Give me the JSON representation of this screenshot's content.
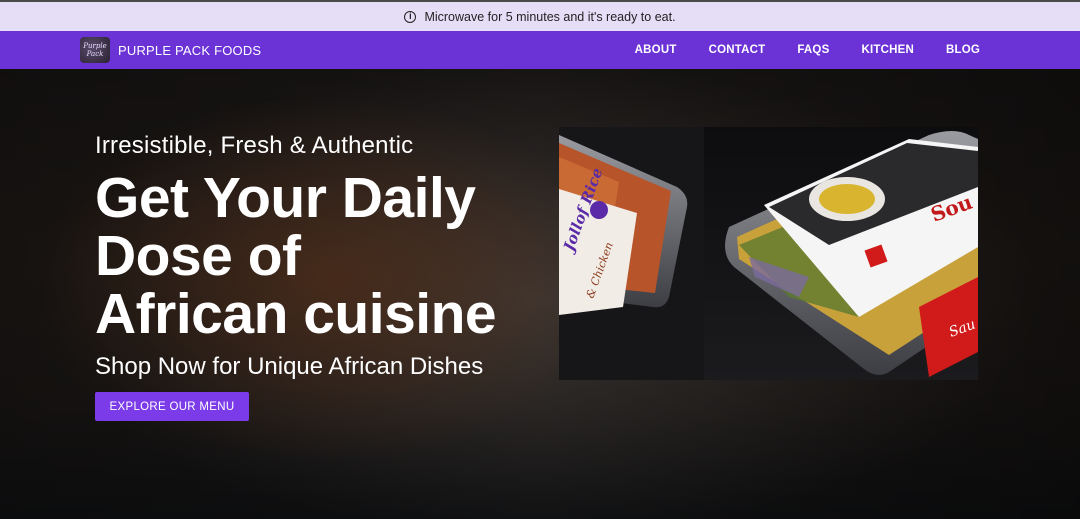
{
  "announcement": {
    "text": "Microwave for 5 minutes and it's ready to eat."
  },
  "brand": {
    "logo_text_top": "Purple",
    "logo_text_bottom": "Pack",
    "name": "PURPLE PACK FOODS"
  },
  "nav": {
    "items": [
      "ABOUT",
      "CONTACT",
      "FAQS",
      "KITCHEN",
      "BLOG"
    ]
  },
  "hero": {
    "eyebrow": "Irresistible, Fresh & Authentic",
    "headline_line1": "Get Your Daily",
    "headline_line2": "Dose of",
    "headline_line3": "African cuisine",
    "subhead": "Shop Now for Unique African Dishes",
    "cta_label": "EXPLORE OUR MENU"
  },
  "colors": {
    "accent": "#6b32d6",
    "button": "#7b3be8",
    "announcement_bg": "#e6ddf7"
  },
  "icons": {
    "announcement": "info-icon"
  }
}
